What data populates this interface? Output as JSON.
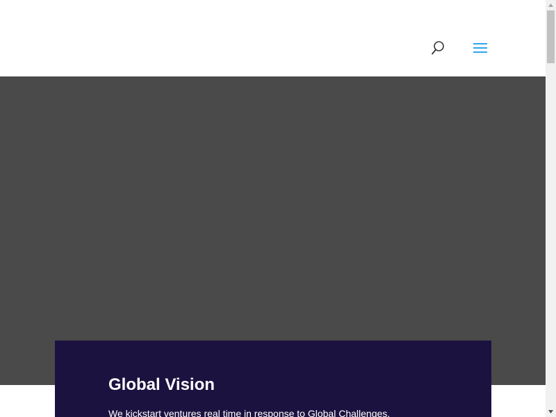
{
  "header": {
    "search_icon": "search-icon",
    "menu_icon": "hamburger-menu-icon",
    "accent_color": "#2ea3f2"
  },
  "hero": {
    "background_color": "#4a4a4a"
  },
  "feature": {
    "title": "Global Vision",
    "text": "We kickstart ventures real time in response to Global Challenges.",
    "background_color": "#1c1240"
  },
  "scrollbar": {
    "position_fraction": 0.0
  }
}
